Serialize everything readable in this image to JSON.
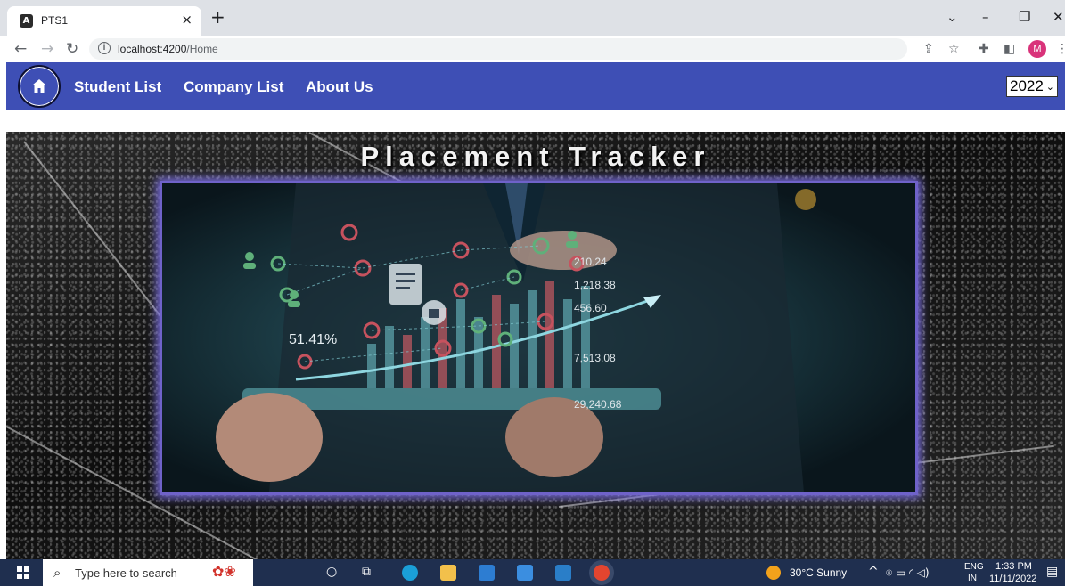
{
  "browser": {
    "tab_title": "PTS1",
    "tab_close": "×",
    "new_tab": "+",
    "url_host": "localhost:4200",
    "url_path": "/Home",
    "profile_initial": "M"
  },
  "navbar": {
    "links": [
      "Student List",
      "Company List",
      "About Us"
    ],
    "year": "2022",
    "accent_color": "#3e4fb5"
  },
  "hero": {
    "title": "Placement Tracker",
    "image_labels": [
      "210.24",
      "1,218.38",
      "456.60",
      "51.41%",
      "7,513.08",
      "29,240.68"
    ]
  },
  "taskbar": {
    "search_placeholder": "Type here to search",
    "weather": "30°C  Sunny",
    "lang_top": "ENG",
    "lang_bottom": "IN",
    "time": "1:33 PM",
    "date": "11/11/2022"
  }
}
